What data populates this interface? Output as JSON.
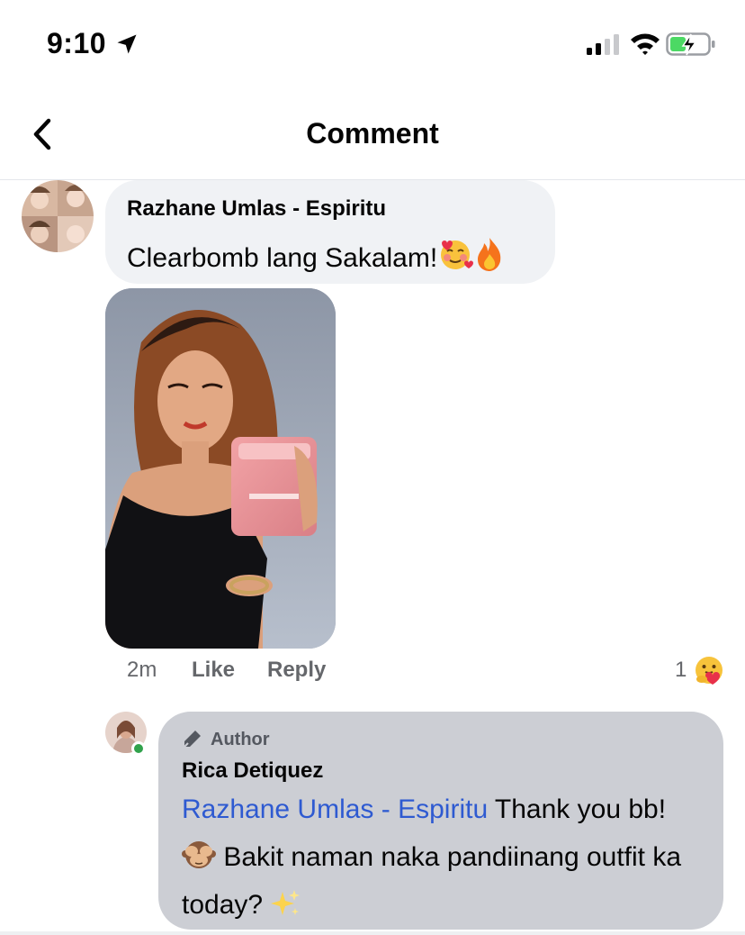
{
  "status_bar": {
    "time": "9:10",
    "location_icon": "location-arrow-icon",
    "signal_icon": "cellular-signal-icon",
    "wifi_icon": "wifi-icon",
    "battery_icon": "battery-charging-icon"
  },
  "header": {
    "title": "Comment",
    "back_icon": "chevron-left-icon"
  },
  "comment": {
    "author": "Razhane Umlas - Espiritu",
    "text": "Clearbomb lang Sakalam!",
    "emojis": [
      "smiling-face-with-hearts-emoji",
      "fire-emoji"
    ],
    "photo": "woman-holding-pink-pouch-photo",
    "time": "2m",
    "like_label": "Like",
    "reply_label": "Reply",
    "reaction_count": "1",
    "reaction_icon": "care-reaction-icon"
  },
  "reply": {
    "badge_label": "Author",
    "badge_icon": "pen-icon",
    "author": "Rica Detiquez",
    "mention": "Razhane Umlas - Espiritu",
    "text_part1": " Thank you bb!",
    "text_part2": " Bakit naman naka pandiinang outfit ka today? ",
    "emojis": [
      "see-no-evil-monkey-emoji",
      "sparkles-emoji"
    ],
    "online": true
  },
  "colors": {
    "bubble": "#f0f2f5",
    "author_bubble": "#ccced4",
    "mention": "#2e5ad1",
    "meta": "#65676b",
    "online": "#31a24c"
  }
}
